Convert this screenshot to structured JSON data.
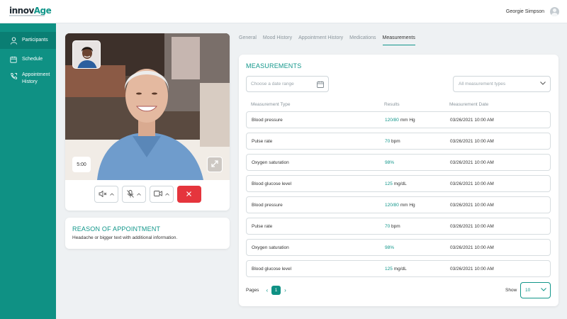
{
  "brand": {
    "logo_main": "innov",
    "logo_accent": "Age"
  },
  "user": {
    "name": "Georgie Simpson"
  },
  "sidebar": {
    "items": [
      {
        "label": "Participants",
        "icon": "person-icon"
      },
      {
        "label": "Schedule",
        "icon": "calendar-icon"
      },
      {
        "label_line1": "Appointment",
        "label_line2": "History",
        "icon": "phone-history-icon"
      }
    ]
  },
  "video": {
    "timer": "5:00"
  },
  "reason": {
    "title": "REASON OF APPOINTMENT",
    "text": "Headache or bigger text with additional information."
  },
  "tabs": [
    "General",
    "Mood History",
    "Appointment History",
    "Medications",
    "Measurements"
  ],
  "measurements": {
    "title": "MEASUREMENTS",
    "date_placeholder": "Choose a date range",
    "type_placeholder": "All measurement types",
    "columns": [
      "Measurement Type",
      "Results",
      "Measurement Date"
    ],
    "rows": [
      {
        "type": "Blood pressure",
        "value": "120/80",
        "unit": "mm Hg",
        "date": "03/26/2021 10:00 AM"
      },
      {
        "type": "Pulse rate",
        "value": "70",
        "unit": "bpm",
        "date": "03/26/2021 10:00 AM"
      },
      {
        "type": "Oxygen saturation",
        "value": "98%",
        "unit": "",
        "date": "03/26/2021 10:00 AM"
      },
      {
        "type": "Blood glucose level",
        "value": "125",
        "unit": "mg/dL",
        "date": "03/26/2021 10:00 AM"
      },
      {
        "type": "Blood pressure",
        "value": "120/80",
        "unit": "mm Hg",
        "date": "03/26/2021 10:00 AM"
      },
      {
        "type": "Pulse rate",
        "value": "70",
        "unit": "bpm",
        "date": "03/26/2021 10:00 AM"
      },
      {
        "type": "Oxygen saturation",
        "value": "98%",
        "unit": "",
        "date": "03/26/2021 10:00 AM"
      },
      {
        "type": "Blood glucose level",
        "value": "125",
        "unit": "mg/dL",
        "date": "03/26/2021 10:00 AM"
      }
    ],
    "pages_label": "Pages",
    "current_page": "1",
    "show_label": "Show",
    "show_value": "10"
  },
  "colors": {
    "brand": "#0f9184",
    "accent": "#11968a",
    "danger": "#e5353d"
  }
}
